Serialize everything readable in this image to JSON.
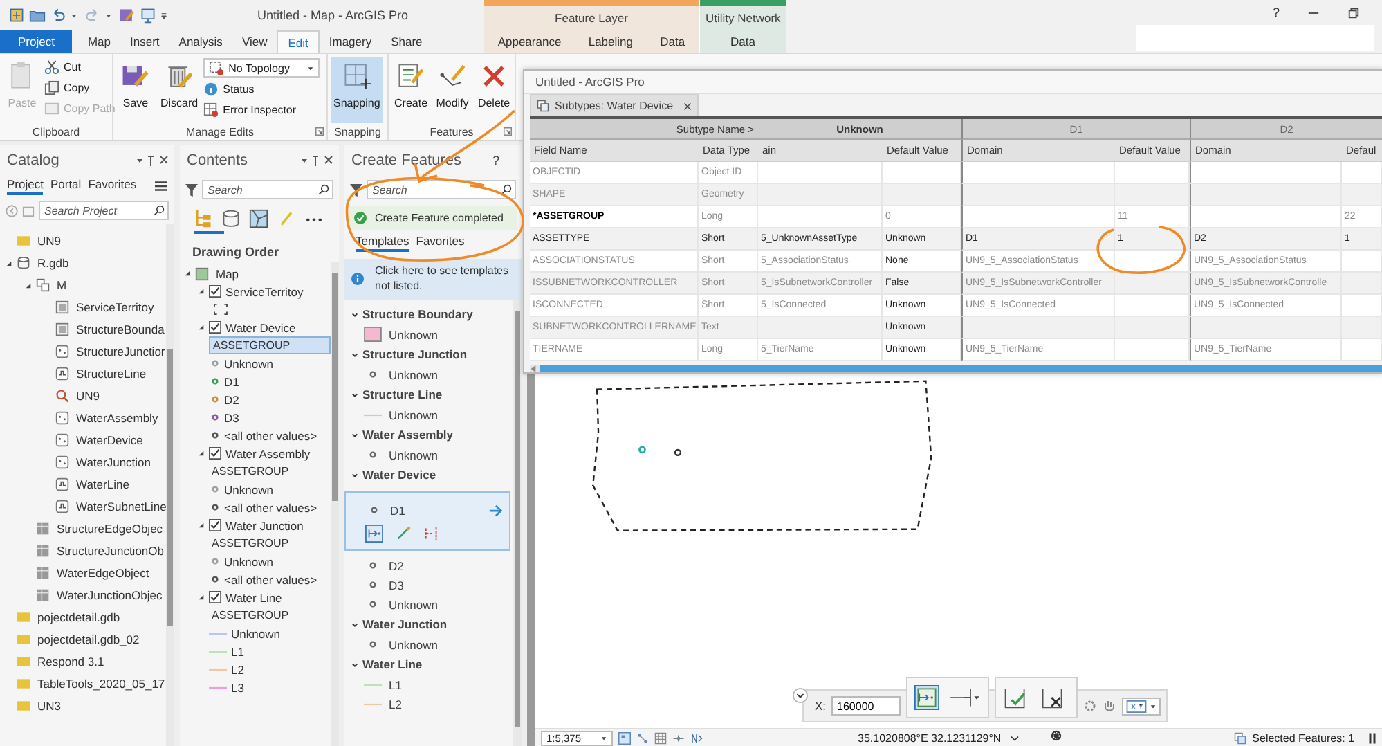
{
  "window": {
    "title": "Untitled - Map - ArcGIS Pro",
    "help": "?"
  },
  "tabs": [
    {
      "label": "Project",
      "kind": "backstage",
      "selected": false
    },
    {
      "label": "Map",
      "kind": "tab",
      "selected": false
    },
    {
      "label": "Insert",
      "kind": "tab",
      "selected": false
    },
    {
      "label": "Analysis",
      "kind": "tab",
      "selected": false
    },
    {
      "label": "View",
      "kind": "tab",
      "selected": false
    },
    {
      "label": "Edit",
      "kind": "tab",
      "selected": true
    },
    {
      "label": "Imagery",
      "kind": "tab",
      "selected": false
    },
    {
      "label": "Share",
      "kind": "tab",
      "selected": false
    }
  ],
  "contextual_tabs": [
    {
      "label": "Feature Layer",
      "color": "#f2a55c",
      "tabs": [
        {
          "label": "Appearance",
          "selected": false
        },
        {
          "label": "Labeling",
          "selected": false
        },
        {
          "label": "Data",
          "selected": false
        }
      ]
    },
    {
      "label": "Utility Network",
      "color": "#3a9f62",
      "tabs": [
        {
          "label": "Data",
          "selected": false
        }
      ]
    }
  ],
  "ribbon": {
    "groups": [
      {
        "label": "Clipboard",
        "launcher": false,
        "items": [
          {
            "kind": "large",
            "label": "Paste",
            "disabled": true,
            "on": false
          },
          {
            "kind": "small",
            "label": "Cut",
            "disabled": false,
            "on": false
          },
          {
            "kind": "small",
            "label": "Copy",
            "disabled": false,
            "on": false
          },
          {
            "kind": "small",
            "label": "Copy Path",
            "disabled": true,
            "on": false
          }
        ]
      },
      {
        "label": "Manage Edits",
        "launcher": true,
        "items": [
          {
            "kind": "large",
            "label": "Save",
            "disabled": false,
            "on": false
          },
          {
            "kind": "large",
            "label": "Discard",
            "disabled": false,
            "on": false
          },
          {
            "kind": "dropdown",
            "label": "No Topology",
            "disabled": false,
            "on": false
          },
          {
            "kind": "small",
            "label": "Status",
            "disabled": false,
            "on": false
          },
          {
            "kind": "small",
            "label": "Error Inspector",
            "disabled": false,
            "on": false
          }
        ]
      },
      {
        "label": "Snapping",
        "launcher": false,
        "items": [
          {
            "kind": "large",
            "label": "Snapping",
            "disabled": false,
            "on": true
          }
        ]
      },
      {
        "label": "Features",
        "launcher": true,
        "items": [
          {
            "kind": "large",
            "label": "Create",
            "disabled": false,
            "on": false
          },
          {
            "kind": "large",
            "label": "Modify",
            "disabled": false,
            "on": false
          },
          {
            "kind": "large",
            "label": "Delete",
            "disabled": false,
            "on": false
          }
        ]
      }
    ]
  },
  "catalog": {
    "title": "Catalog",
    "tabs": [
      {
        "label": "Project",
        "selected": true
      },
      {
        "label": "Portal",
        "selected": false
      },
      {
        "label": "Favorites",
        "selected": false
      }
    ],
    "search": {
      "placeholder": "Search Project"
    },
    "items": [
      {
        "label": "UN9",
        "kind": "folder"
      },
      {
        "label": "R.gdb",
        "kind": "gdb",
        "expanded": true,
        "children": [
          {
            "label": "M",
            "kind": "dataset",
            "expanded": true,
            "children": [
              {
                "label": "ServiceTerritoy",
                "kind": "polygon"
              },
              {
                "label": "StructureBounda",
                "kind": "polygon"
              },
              {
                "label": "StructureJunctior",
                "kind": "point"
              },
              {
                "label": "StructureLine",
                "kind": "line"
              },
              {
                "label": "UN9",
                "kind": "network"
              },
              {
                "label": "WaterAssembly",
                "kind": "point"
              },
              {
                "label": "WaterDevice",
                "kind": "point"
              },
              {
                "label": "WaterJunction",
                "kind": "point"
              },
              {
                "label": "WaterLine",
                "kind": "line"
              },
              {
                "label": "WaterSubnetLine",
                "kind": "line"
              }
            ]
          },
          {
            "label": "StructureEdgeObjec",
            "kind": "table"
          },
          {
            "label": "StructureJunctionOb",
            "kind": "table"
          },
          {
            "label": "WaterEdgeObject",
            "kind": "table"
          },
          {
            "label": "WaterJunctionObjec",
            "kind": "table"
          }
        ]
      },
      {
        "label": "pojectdetail.gdb",
        "kind": "folder"
      },
      {
        "label": "pojectdetail.gdb_02",
        "kind": "folder"
      },
      {
        "label": "Respond 3.1",
        "kind": "folder"
      },
      {
        "label": "TableTools_2020_05_17",
        "kind": "folder"
      },
      {
        "label": "UN3",
        "kind": "folder"
      }
    ]
  },
  "contents": {
    "title": "Contents",
    "search": {
      "placeholder": "Search"
    },
    "heading": "Drawing Order",
    "map": {
      "label": "Map",
      "expanded": true
    },
    "layers": [
      {
        "label": "ServiceTerritoy",
        "checked": true,
        "expanded": true,
        "kind": "polygon"
      },
      {
        "label": "Water Device",
        "checked": true,
        "expanded": true,
        "kind": "point",
        "field": {
          "label": "ASSETGROUP",
          "selected": true
        },
        "classes": [
          {
            "label": "Unknown",
            "color": "#9aa0a6"
          },
          {
            "label": "D1",
            "color": "#3aa05a"
          },
          {
            "label": "D2",
            "color": "#c8903c"
          },
          {
            "label": "D3",
            "color": "#8a5aa8"
          },
          {
            "label": "<all other values>",
            "color": "#555555"
          }
        ]
      },
      {
        "label": "Water Assembly",
        "checked": true,
        "expanded": true,
        "kind": "point",
        "field": {
          "label": "ASSETGROUP",
          "selected": false
        },
        "classes": [
          {
            "label": "Unknown",
            "color": "#9aa0a6"
          },
          {
            "label": "<all other values>",
            "color": "#555555"
          }
        ]
      },
      {
        "label": "Water Junction",
        "checked": true,
        "expanded": true,
        "kind": "point",
        "field": {
          "label": "ASSETGROUP",
          "selected": false
        },
        "classes": [
          {
            "label": "Unknown",
            "color": "#9aa0a6"
          },
          {
            "label": "<all other values>",
            "color": "#555555"
          }
        ]
      },
      {
        "label": "Water Line",
        "checked": true,
        "expanded": true,
        "kind": "line",
        "field": {
          "label": "ASSETGROUP",
          "selected": false
        },
        "classes": [
          {
            "label": "Unknown",
            "color": "#b8c8ec"
          },
          {
            "label": "L1",
            "color": "#b8e4b8"
          },
          {
            "label": "L2",
            "color": "#f0c8a0"
          },
          {
            "label": "L3",
            "color": "#e8a0e0"
          }
        ]
      }
    ]
  },
  "create_features": {
    "title": "Create Features",
    "help": "?",
    "search": {
      "placeholder": "Search"
    },
    "notice": "Create Feature completed",
    "tabs": [
      {
        "label": "Templates",
        "selected": true
      },
      {
        "label": "Favorites",
        "selected": false
      }
    ],
    "info": "Click here to see templates not listed.",
    "groups": [
      {
        "label": "Structure Boundary",
        "expanded": true,
        "templates": [
          {
            "label": "Unknown",
            "kind": "polygon",
            "color": "#f4b8d0",
            "selected": false
          }
        ]
      },
      {
        "label": "Structure Junction",
        "expanded": true,
        "templates": [
          {
            "label": "Unknown",
            "kind": "point",
            "color": "#666666",
            "selected": false
          }
        ]
      },
      {
        "label": "Structure Line",
        "expanded": true,
        "templates": [
          {
            "label": "Unknown",
            "kind": "line",
            "color": "#f0b8c8",
            "selected": false
          }
        ]
      },
      {
        "label": "Water Assembly",
        "expanded": true,
        "templates": [
          {
            "label": "Unknown",
            "kind": "point",
            "color": "#666666",
            "selected": false
          }
        ]
      },
      {
        "label": "Water Device",
        "expanded": true,
        "templates": [
          {
            "label": "D1",
            "kind": "point",
            "color": "#666666",
            "selected": true
          },
          {
            "label": "D2",
            "kind": "point",
            "color": "#666666",
            "selected": false
          },
          {
            "label": "D3",
            "kind": "point",
            "color": "#666666",
            "selected": false
          },
          {
            "label": "Unknown",
            "kind": "point",
            "color": "#666666",
            "selected": false
          }
        ]
      },
      {
        "label": "Water Junction",
        "expanded": true,
        "templates": [
          {
            "label": "Unknown",
            "kind": "point",
            "color": "#666666",
            "selected": false
          }
        ]
      },
      {
        "label": "Water Line",
        "expanded": true,
        "templates": [
          {
            "label": "L1",
            "kind": "line",
            "color": "#b8e4b8",
            "selected": false
          },
          {
            "label": "L2",
            "kind": "line",
            "color": "#f0c8a0",
            "selected": false
          }
        ]
      }
    ]
  },
  "subtypes_window": {
    "title": "Untitled - ArcGIS Pro",
    "tab": "Subtypes: Water Device",
    "subtype_header": "Subtype Name >",
    "subtypes": [
      {
        "label": "Unknown",
        "default": true
      },
      {
        "label": "D1",
        "default": false
      },
      {
        "label": "D2",
        "default": false
      }
    ],
    "columns": [
      "Field Name",
      "Data Type",
      "ain",
      "Default Value",
      "Domain",
      "Default Value",
      "Domain",
      "Defaul"
    ],
    "rows": [
      {
        "disabled": true,
        "required": false,
        "cells": [
          "OBJECTID",
          "Object ID",
          null,
          null,
          null,
          null,
          null,
          null
        ]
      },
      {
        "disabled": true,
        "required": false,
        "cells": [
          "SHAPE",
          "Geometry",
          null,
          null,
          null,
          null,
          null,
          null
        ]
      },
      {
        "disabled": true,
        "required": true,
        "cells": [
          "*ASSETGROUP",
          "Long",
          null,
          "0",
          null,
          "11",
          null,
          "22"
        ]
      },
      {
        "disabled": false,
        "required": false,
        "cells": [
          "ASSETTYPE",
          "Short",
          "5_UnknownAssetType",
          "Unknown",
          "D1",
          "1",
          "D2",
          "1"
        ]
      },
      {
        "disabled": true,
        "required": false,
        "cells": [
          "ASSOCIATIONSTATUS",
          "Short",
          "5_AssociationStatus",
          "None",
          "UN9_5_AssociationStatus",
          null,
          "UN9_5_AssociationStatus",
          null
        ]
      },
      {
        "disabled": true,
        "required": false,
        "cells": [
          "ISSUBNETWORKCONTROLLER",
          "Short",
          "5_IsSubnetworkController",
          "False",
          "UN9_5_IsSubnetworkController",
          null,
          "UN9_5_IsSubnetworkControlle",
          null
        ]
      },
      {
        "disabled": true,
        "required": false,
        "cells": [
          "ISCONNECTED",
          "Short",
          "5_IsConnected",
          "Unknown",
          "UN9_5_IsConnected",
          null,
          "UN9_5_IsConnected",
          null
        ]
      },
      {
        "disabled": true,
        "required": false,
        "cells": [
          "SUBNETWORKCONTROLLERNAME",
          "Text",
          null,
          "Unknown",
          null,
          null,
          null,
          null
        ]
      },
      {
        "disabled": true,
        "required": false,
        "cells": [
          "TIERNAME",
          "Long",
          "5_TierName",
          "Unknown",
          "UN9_5_TierName",
          null,
          "UN9_5_TierName",
          null
        ]
      }
    ]
  },
  "map": {
    "coordinate_input": {
      "label": "X:",
      "value": "160000"
    },
    "status_bar": {
      "scale": "1:5,375",
      "coordinates": "35.1020808°E 32.1231129°N",
      "selection": "Selected Features: 1"
    }
  }
}
